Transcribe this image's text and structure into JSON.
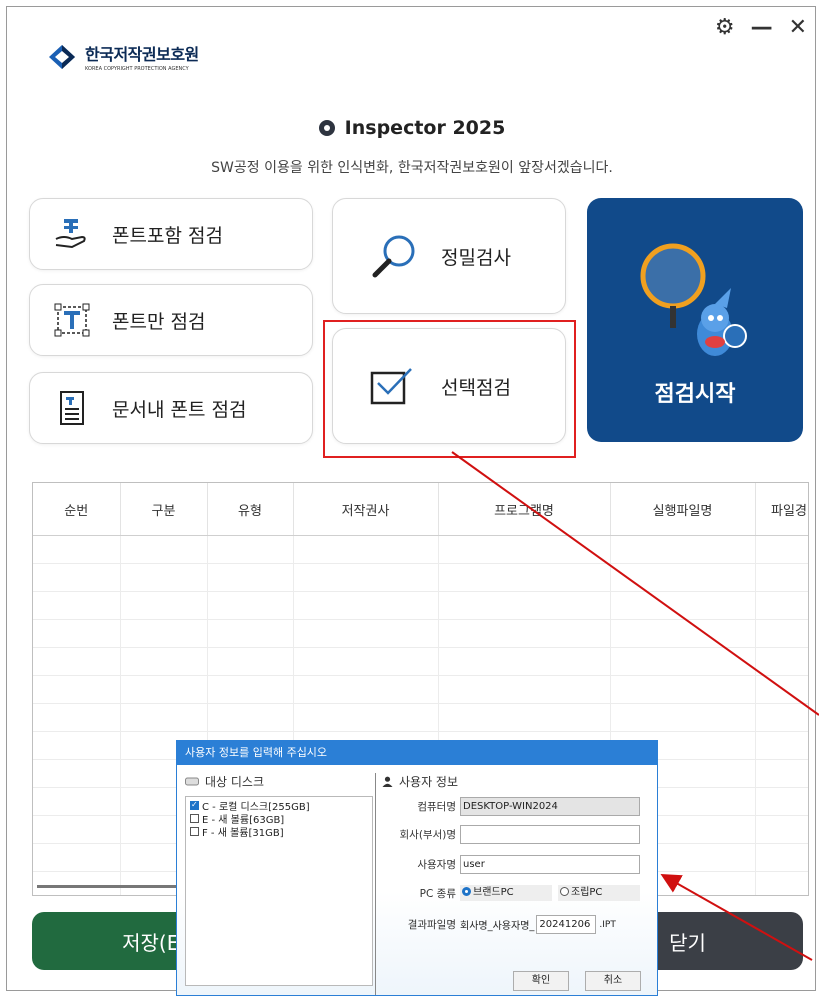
{
  "window": {
    "controls": {
      "settings": "⚙",
      "minimize": "—",
      "close": "✕"
    }
  },
  "logo": {
    "main": "한국저작권보호원",
    "sub": "KOREA COPYRIGHT PROTECTION AGENCY"
  },
  "app": {
    "title": "Inspector 2025",
    "subtitle": "SW공정 이용을 위한 인식변화, 한국저작권보호원이 앞장서겠습니다."
  },
  "menu": {
    "font_include": "폰트포함 점검",
    "font_only": "폰트만 점검",
    "doc_font": "문서내 폰트 점검",
    "precise": "정밀검사",
    "select": "선택점검",
    "start": "점검시작"
  },
  "table": {
    "columns": [
      "순번",
      "구분",
      "유형",
      "저작권사",
      "프로그램명",
      "실행파일명",
      "파일경"
    ]
  },
  "buttons": {
    "save": "저장(Exc",
    "close": "닫기"
  },
  "dialog": {
    "title": "사용자 정보를 입력해 주십시오",
    "disk_header": "대상 디스크",
    "disks": [
      {
        "label": "C - 로컬 디스크[255GB]",
        "checked": true
      },
      {
        "label": "E - 새 볼륨[63GB]",
        "checked": false
      },
      {
        "label": "F - 새 볼륨[31GB]",
        "checked": false
      }
    ],
    "user_header": "사용자 정보",
    "computer_label": "컴퓨터명",
    "computer_value": "DESKTOP-WIN2024",
    "company_label": "회사(부서)명",
    "company_value": "",
    "user_label": "사용자명",
    "user_value": "user",
    "pc_type_label": "PC 종류",
    "pc_brand": "브랜드PC",
    "pc_assembled": "조립PC",
    "result_label": "결과파일명",
    "result_prefix": "회사명_사용자명_",
    "result_date": "20241206",
    "result_ext": ".IPT",
    "ok": "확인",
    "cancel": "취소"
  },
  "colors": {
    "start_bg": "#114a8a",
    "save_bg": "#216a3f",
    "close_bg": "#3b3f46",
    "dialog_accent": "#2b7fd6",
    "highlight": "#e02020"
  }
}
